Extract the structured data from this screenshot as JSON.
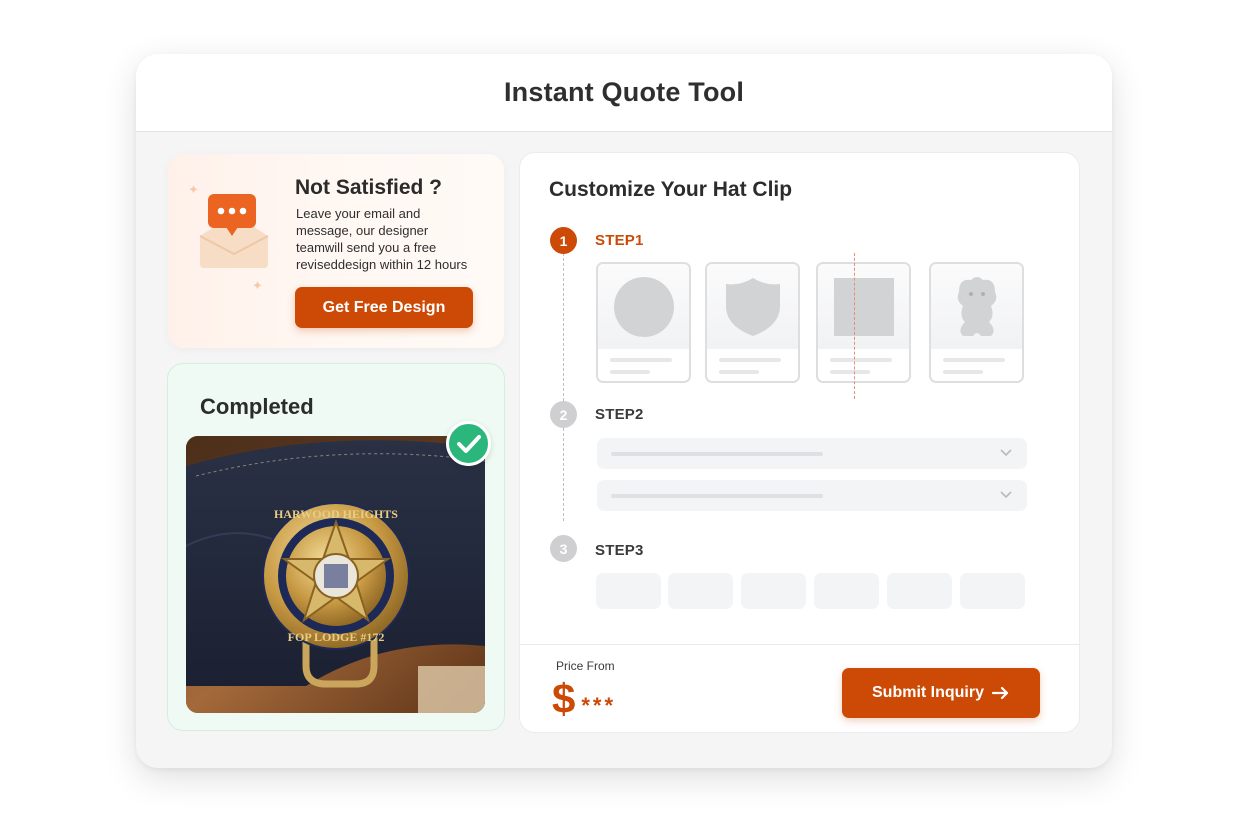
{
  "window": {
    "title": "Instant Quote Tool"
  },
  "promo": {
    "title": "Not Satisfied ?",
    "lines": [
      "Leave your email and",
      "message, our designer",
      "teamwill send you a free",
      "reviseddesign within 12 hours"
    ],
    "button_label": "Get Free Design",
    "icon": "mail-message-icon"
  },
  "completed": {
    "title": "Completed",
    "status_icon": "check-icon",
    "image_alt": "Photo of a gold star hat clip on a navy cap"
  },
  "customize": {
    "title": "Customize Your Hat Clip",
    "steps": [
      {
        "number": "1",
        "label": "STEP1",
        "state": "active"
      },
      {
        "number": "2",
        "label": "STEP2",
        "state": "inactive"
      },
      {
        "number": "3",
        "label": "STEP3",
        "state": "inactive"
      }
    ],
    "shape_options": [
      "circle-shape-icon",
      "shield-shape-icon",
      "square-shape-icon",
      "custom-shape-icon"
    ],
    "price": {
      "label": "Price From",
      "currency": "$",
      "value": "***"
    },
    "submit_label": "Submit Inquiry"
  },
  "colors": {
    "accent": "#cc4a06",
    "success": "#2bb77b",
    "muted": "#cfcfd2"
  }
}
